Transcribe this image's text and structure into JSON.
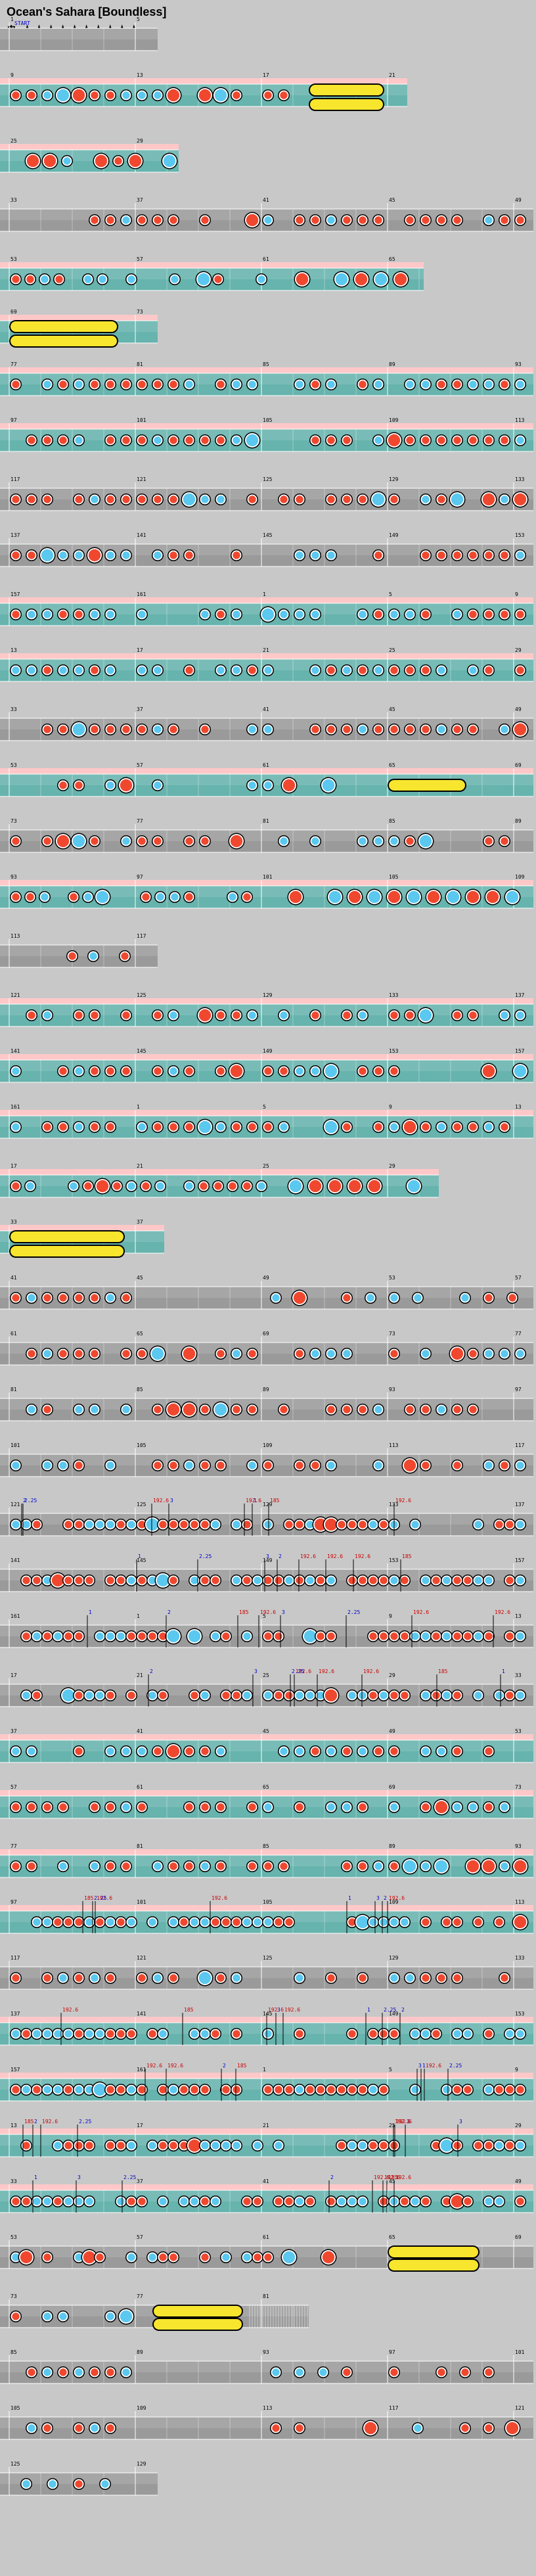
{
  "song_title": "Ocean's Sahara [Boundless]",
  "course_icon": "oni-course-icon",
  "course_label": "鬼",
  "stars_text": "★★★★★★★★★★",
  "star_count": 10,
  "start_marker": "START",
  "colors": {
    "background": "#c8c8c8",
    "lane": "#9a9a9a",
    "lane_gogo": "#67b3ad",
    "gogo_strip": "#ffc8c8",
    "don": "#f0482f",
    "ka": "#5bc8ef",
    "drumroll": "#f7e52e",
    "bpm_text": "#cc0000",
    "scroll_text": "#0000cc"
  },
  "measure_numbers": [
    "1",
    "5",
    "9",
    "13",
    "17",
    "21",
    "25",
    "29",
    "33",
    "37",
    "41",
    "45",
    "49",
    "53",
    "57",
    "61",
    "65",
    "69",
    "73",
    "77",
    "81",
    "85",
    "89",
    "93",
    "97",
    "101",
    "105",
    "109",
    "113",
    "117",
    "121",
    "125",
    "129",
    "133",
    "137",
    "141",
    "145",
    "149",
    "153",
    "157",
    "161"
  ],
  "bpm_marks": [
    "185",
    "192.6",
    "195",
    "185",
    "185",
    "192.6",
    "185",
    "192.6",
    "195",
    "185.79"
  ],
  "scroll_marks": [
    "1",
    "1.5",
    "2",
    "0.5",
    "3",
    "0.75",
    "2.25",
    "1.25"
  ]
}
